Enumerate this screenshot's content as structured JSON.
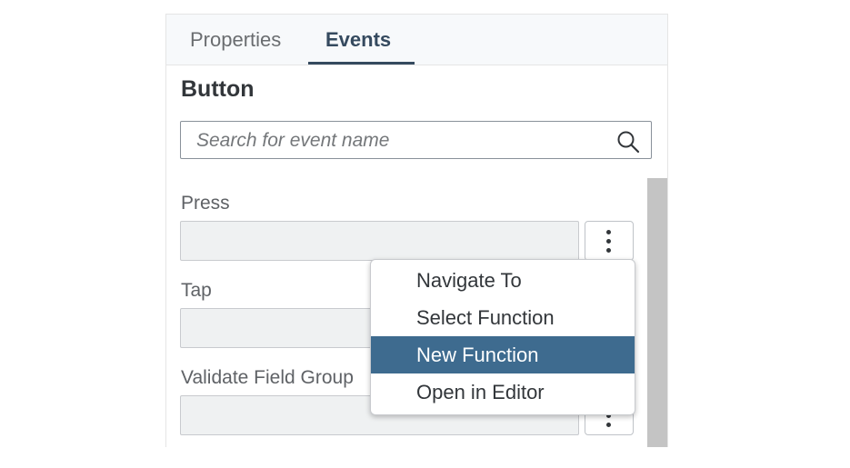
{
  "tabs": [
    {
      "label": "Properties",
      "active": false
    },
    {
      "label": "Events",
      "active": true
    }
  ],
  "section_title": "Button",
  "search": {
    "placeholder": "Search for event name",
    "value": ""
  },
  "events": [
    {
      "label": "Press",
      "value": ""
    },
    {
      "label": "Tap",
      "value": ""
    },
    {
      "label": "Validate Field Group",
      "value": ""
    }
  ],
  "context_menu": {
    "items": [
      {
        "label": "Navigate To"
      },
      {
        "label": "Select Function"
      },
      {
        "label": "New Function",
        "highlighted": true
      },
      {
        "label": "Open in Editor"
      }
    ]
  },
  "colors": {
    "accent": "#354a5f",
    "highlight": "#3e6b8f",
    "field_bg": "#eff1f2"
  }
}
